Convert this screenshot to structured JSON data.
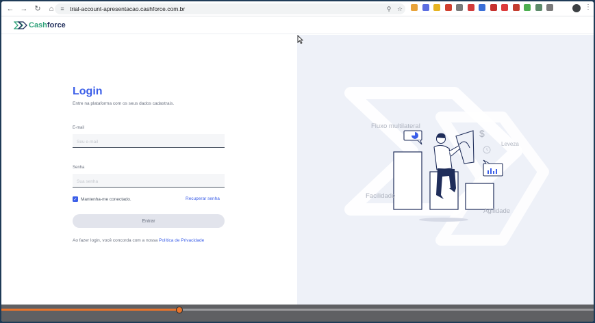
{
  "browser": {
    "url": "trial-account-apresentacao.cashforce.com.br",
    "nav_icons": [
      "back-arrow-icon",
      "forward-arrow-icon",
      "reload-icon",
      "home-icon"
    ],
    "omnibox_icons": [
      "site-settings-icon",
      "password-key-icon",
      "bookmark-star-icon"
    ],
    "extension_colors": [
      "#e8a33a",
      "#5b6ee1",
      "#e6b422",
      "#d0402f",
      "#7a7a7a",
      "#d23b3b",
      "#3a6fd8",
      "#c6312e",
      "#dd3b3b",
      "#c33d2f",
      "#4caf50",
      "#5c8a6a",
      "#7a7a7a"
    ]
  },
  "app": {
    "logo_cash": "Cash",
    "logo_force": "force",
    "brand_green": "#31a37b",
    "brand_navy": "#1f2d5a",
    "accent_blue": "#3b5ee8"
  },
  "login": {
    "title": "Login",
    "subtitle": "Entre na plataforma com os seus dados cadastrais.",
    "email_label": "E-mail",
    "email_placeholder": "Seu e-mail",
    "email_value": "",
    "password_label": "Senha",
    "password_placeholder": "Sua senha",
    "password_value": "",
    "remember_label": "Mantenha-me conectado.",
    "remember_checked": true,
    "recover_link": "Recuperar senha",
    "submit_label": "Entrar",
    "terms_text": "Ao fazer login, você concorda com a nossa",
    "terms_link": "Política de Privacidade"
  },
  "illustration": {
    "label_fluxo": "Fluxo multilateral",
    "label_leveza": "Leveza",
    "label_facilidade": "Facilidade",
    "label_agilidade": "Agilidade",
    "currency_symbol": "$"
  },
  "video": {
    "progress": 0.3
  }
}
